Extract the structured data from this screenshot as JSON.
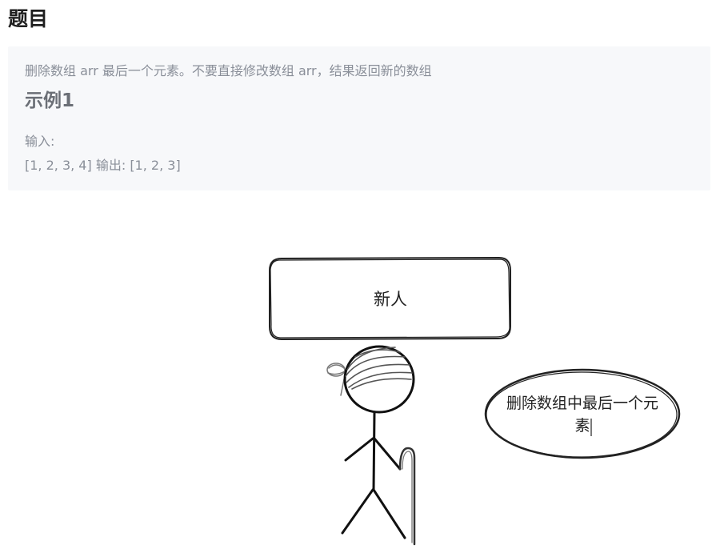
{
  "heading": "题目",
  "problem": {
    "description": "删除数组 arr 最后一个元素。不要直接修改数组 arr，结果返回新的数组",
    "example_title": "示例1",
    "input_label": "输入:",
    "input_value": "[1, 2, 3, 4]",
    "output_label": "输出:",
    "output_value": "[1, 2, 3]"
  },
  "illustration": {
    "box_label": "新人",
    "bubble_line1": "删除数组中最后一个元",
    "bubble_line2": "素"
  },
  "colors": {
    "panel_bg": "#f7f8fa",
    "muted_text": "#8a8f99",
    "heading_text": "#1f1f1f",
    "ink": "#222222"
  }
}
